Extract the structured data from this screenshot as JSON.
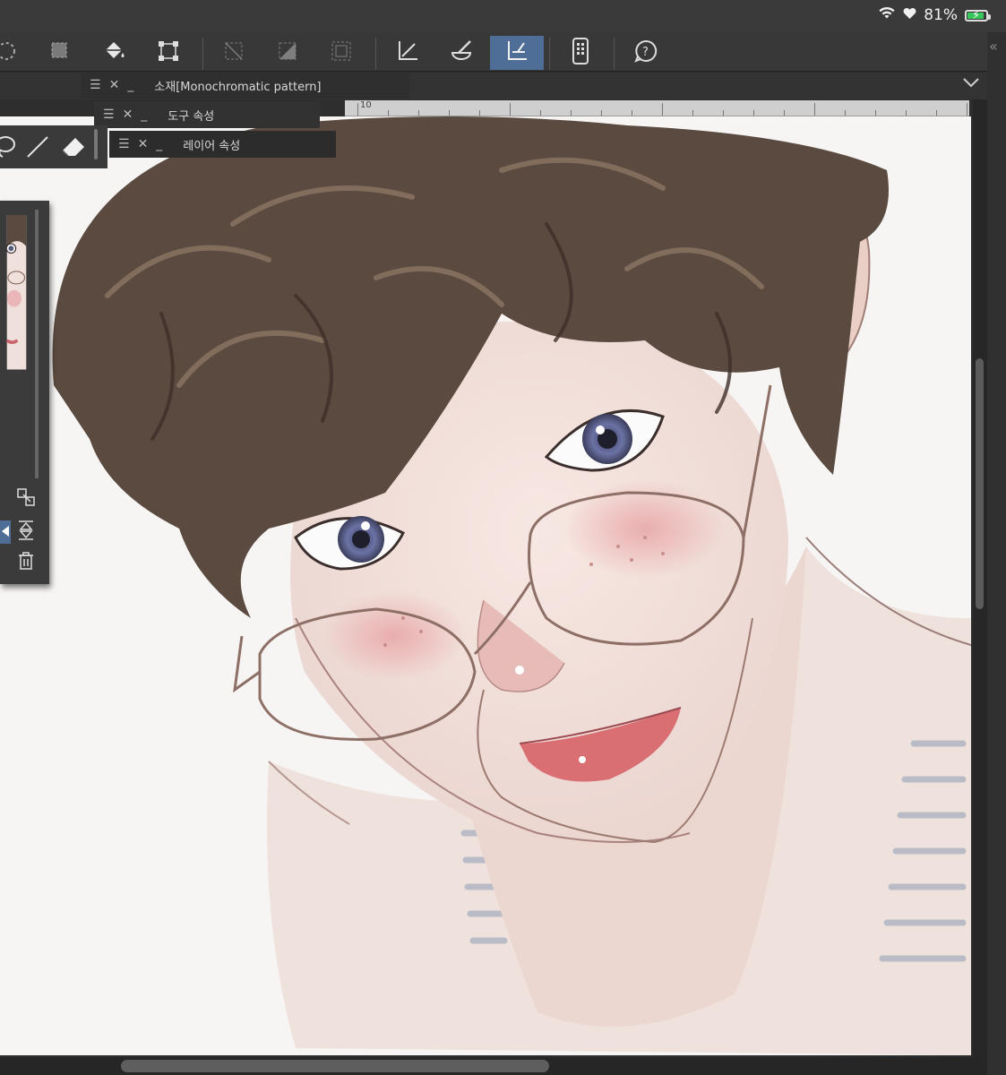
{
  "status": {
    "battery": "81%",
    "battery_level": 0.81,
    "icons": [
      "wifi-icon",
      "heart-icon",
      "battery-charging-icon"
    ]
  },
  "toolbar": {
    "tools": [
      {
        "name": "selection-burst",
        "active": false
      },
      {
        "name": "selection-layer",
        "active": false
      },
      {
        "name": "fill-bucket",
        "active": false
      },
      {
        "name": "transform",
        "active": false
      },
      {
        "name": "deselect",
        "active": false
      },
      {
        "name": "invert-selection",
        "active": false
      },
      {
        "name": "selection-border",
        "active": false
      },
      {
        "name": "ruler-vector",
        "active": false
      },
      {
        "name": "brush-color",
        "active": false
      },
      {
        "name": "perspective-ruler",
        "active": true
      },
      {
        "name": "mobile-device",
        "active": false
      },
      {
        "name": "help",
        "active": false
      }
    ]
  },
  "panels": {
    "material": "소재[Monochromatic pattern]",
    "tool_property": "도구 속성",
    "layer_property": "레이어 속성"
  },
  "ruler": {
    "label": "10"
  },
  "colors": {
    "ui_dark": "#383838",
    "active_tool": "#4e6d97",
    "battery_green": "#35c759",
    "paper": "#f6f5f4"
  }
}
